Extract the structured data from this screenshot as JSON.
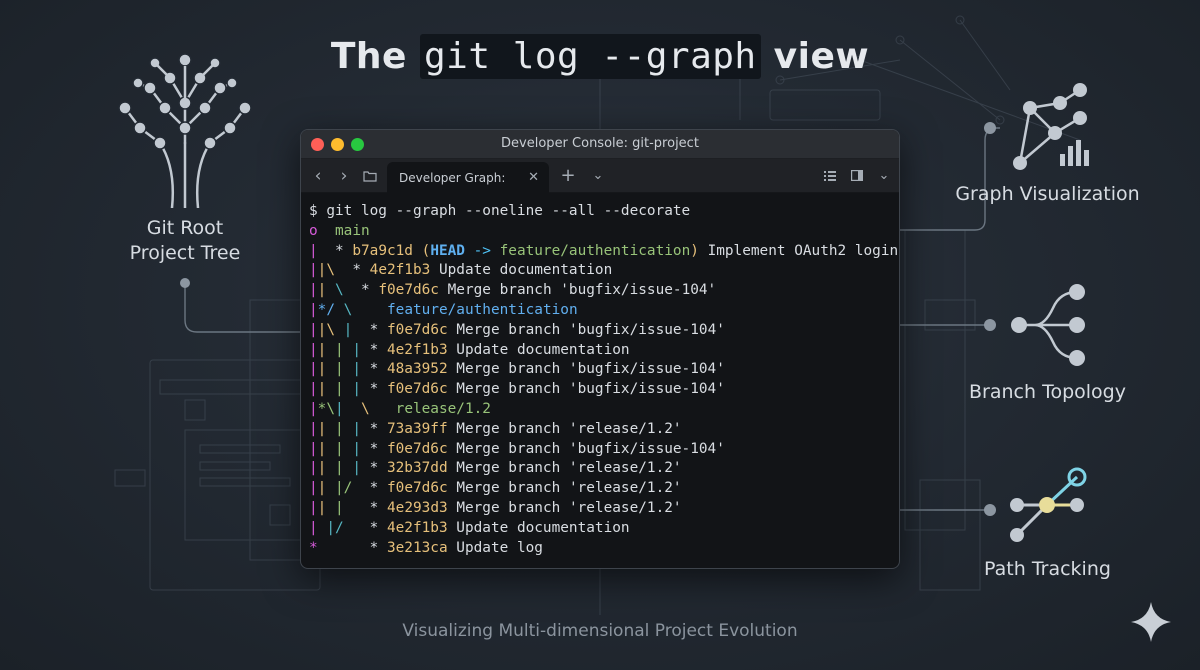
{
  "header": {
    "title_pre": "The ",
    "title_code": "git log --graph",
    "title_post": " view"
  },
  "footer": {
    "subtitle": "Visualizing Multi-dimensional Project Evolution"
  },
  "left_panel": {
    "label_line1": "Git Root",
    "label_line2": "Project Tree"
  },
  "right_panel": {
    "graph_visualization": "Graph Visualization",
    "branch_topology": "Branch Topology",
    "path_tracking": "Path Tracking"
  },
  "window": {
    "title": "Developer Console: git-project",
    "tab_label": "Developer Graph:",
    "close_glyph": "✕",
    "new_tab_glyph": "+",
    "back_glyph": "‹",
    "forward_glyph": "›",
    "dropdown_glyph": "⌄"
  },
  "terminal": {
    "lines": [
      [
        {
          "t": "$ ",
          "c": "pm"
        },
        {
          "t": "git log --graph --oneline --all --decorate",
          "c": "wh"
        }
      ],
      [
        {
          "t": "o  ",
          "c": "mg"
        },
        {
          "t": "main",
          "c": "gr"
        }
      ],
      [
        {
          "t": "|  ",
          "c": "mg"
        },
        {
          "t": "* ",
          "c": "wh"
        },
        {
          "t": "b7a9c1d ",
          "c": "yl"
        },
        {
          "t": "(",
          "c": "yl"
        },
        {
          "t": "HEAD",
          "c": "hd"
        },
        {
          "t": " -> ",
          "c": "lb"
        },
        {
          "t": "feature/authentication",
          "c": "gr"
        },
        {
          "t": ")",
          "c": "yl"
        },
        {
          "t": " Implement OAuth2 login",
          "c": "wh"
        }
      ],
      [
        {
          "t": "|",
          "c": "mg"
        },
        {
          "t": "|\\",
          "c": "yl"
        },
        {
          "t": "  * ",
          "c": "wh"
        },
        {
          "t": "4e2f1b3 ",
          "c": "yl"
        },
        {
          "t": "Update documentation",
          "c": "wh"
        }
      ],
      [
        {
          "t": "|",
          "c": "mg"
        },
        {
          "t": "| ",
          "c": "yl"
        },
        {
          "t": "\\",
          "c": "cy"
        },
        {
          "t": "  * ",
          "c": "wh"
        },
        {
          "t": "f0e7d6c ",
          "c": "yl"
        },
        {
          "t": "Merge branch 'bugfix/issue-104'",
          "c": "wh"
        }
      ],
      [
        {
          "t": "|",
          "c": "mg"
        },
        {
          "t": "*/ ",
          "c": "bl"
        },
        {
          "t": "\\    ",
          "c": "cy"
        },
        {
          "t": "feature/authentication",
          "c": "bl"
        }
      ],
      [
        {
          "t": "|",
          "c": "mg"
        },
        {
          "t": "|\\ ",
          "c": "yl"
        },
        {
          "t": "| ",
          "c": "cy"
        },
        {
          "t": " * ",
          "c": "wh"
        },
        {
          "t": "f0e7d6c ",
          "c": "yl"
        },
        {
          "t": "Merge branch 'bugfix/issue-104'",
          "c": "wh"
        }
      ],
      [
        {
          "t": "|",
          "c": "mg"
        },
        {
          "t": "| ",
          "c": "yl"
        },
        {
          "t": "| ",
          "c": "gr"
        },
        {
          "t": "| ",
          "c": "cy"
        },
        {
          "t": "* ",
          "c": "wh"
        },
        {
          "t": "4e2f1b3 ",
          "c": "yl"
        },
        {
          "t": "Update documentation",
          "c": "wh"
        }
      ],
      [
        {
          "t": "|",
          "c": "mg"
        },
        {
          "t": "| ",
          "c": "yl"
        },
        {
          "t": "| ",
          "c": "gr"
        },
        {
          "t": "| ",
          "c": "cy"
        },
        {
          "t": "* ",
          "c": "wh"
        },
        {
          "t": "48a3952 ",
          "c": "yl"
        },
        {
          "t": "Merge branch 'bugfix/issue-104'",
          "c": "wh"
        }
      ],
      [
        {
          "t": "|",
          "c": "mg"
        },
        {
          "t": "| ",
          "c": "yl"
        },
        {
          "t": "| ",
          "c": "gr"
        },
        {
          "t": "| ",
          "c": "cy"
        },
        {
          "t": "* ",
          "c": "wh"
        },
        {
          "t": "f0e7d6c ",
          "c": "yl"
        },
        {
          "t": "Merge branch 'bugfix/issue-104'",
          "c": "wh"
        }
      ],
      [
        {
          "t": "|",
          "c": "mg"
        },
        {
          "t": "*\\",
          "c": "gr"
        },
        {
          "t": "|  ",
          "c": "cy"
        },
        {
          "t": "\\   ",
          "c": "yl"
        },
        {
          "t": "release/1.2",
          "c": "gr"
        }
      ],
      [
        {
          "t": "|",
          "c": "mg"
        },
        {
          "t": "| ",
          "c": "yl"
        },
        {
          "t": "| ",
          "c": "gr"
        },
        {
          "t": "| ",
          "c": "cy"
        },
        {
          "t": "* ",
          "c": "wh"
        },
        {
          "t": "73a39ff ",
          "c": "yl"
        },
        {
          "t": "Merge branch 'release/1.2'",
          "c": "wh"
        }
      ],
      [
        {
          "t": "|",
          "c": "mg"
        },
        {
          "t": "| ",
          "c": "yl"
        },
        {
          "t": "| ",
          "c": "gr"
        },
        {
          "t": "| ",
          "c": "cy"
        },
        {
          "t": "* ",
          "c": "wh"
        },
        {
          "t": "f0e7d6c ",
          "c": "yl"
        },
        {
          "t": "Merge branch 'bugfix/issue-104'",
          "c": "wh"
        }
      ],
      [
        {
          "t": "|",
          "c": "mg"
        },
        {
          "t": "| ",
          "c": "yl"
        },
        {
          "t": "| ",
          "c": "gr"
        },
        {
          "t": "| ",
          "c": "cy"
        },
        {
          "t": "* ",
          "c": "wh"
        },
        {
          "t": "32b37dd ",
          "c": "yl"
        },
        {
          "t": "Merge branch 'release/1.2'",
          "c": "wh"
        }
      ],
      [
        {
          "t": "|",
          "c": "mg"
        },
        {
          "t": "| ",
          "c": "yl"
        },
        {
          "t": "|/ ",
          "c": "gr"
        },
        {
          "t": " * ",
          "c": "wh"
        },
        {
          "t": "f0e7d6c ",
          "c": "yl"
        },
        {
          "t": "Merge branch 'release/1.2'",
          "c": "wh"
        }
      ],
      [
        {
          "t": "|",
          "c": "mg"
        },
        {
          "t": "| ",
          "c": "yl"
        },
        {
          "t": "|  ",
          "c": "gr"
        },
        {
          "t": " * ",
          "c": "wh"
        },
        {
          "t": "4e293d3 ",
          "c": "yl"
        },
        {
          "t": "Merge branch 'release/1.2'",
          "c": "wh"
        }
      ],
      [
        {
          "t": "|",
          "c": "mg"
        },
        {
          "t": " |/ ",
          "c": "cy"
        },
        {
          "t": "  * ",
          "c": "wh"
        },
        {
          "t": "4e2f1b3 ",
          "c": "yl"
        },
        {
          "t": "Update documentation",
          "c": "wh"
        }
      ],
      [
        {
          "t": "*      ",
          "c": "mg"
        },
        {
          "t": "* ",
          "c": "wh"
        },
        {
          "t": "3e213ca ",
          "c": "yl"
        },
        {
          "t": "Update log",
          "c": "wh"
        }
      ]
    ]
  },
  "colors": {
    "red": "#ff5f57",
    "yellow": "#febc2e",
    "green": "#28c840",
    "accent_cyan": "#7fd3e6",
    "accent_yellow": "#e8dd9a"
  },
  "icons": [
    "tree-icon",
    "graph-visualization-icon",
    "branch-topology-icon",
    "path-tracking-icon",
    "sparkle-icon",
    "folder-icon",
    "list-icon",
    "sidebar-icon"
  ]
}
